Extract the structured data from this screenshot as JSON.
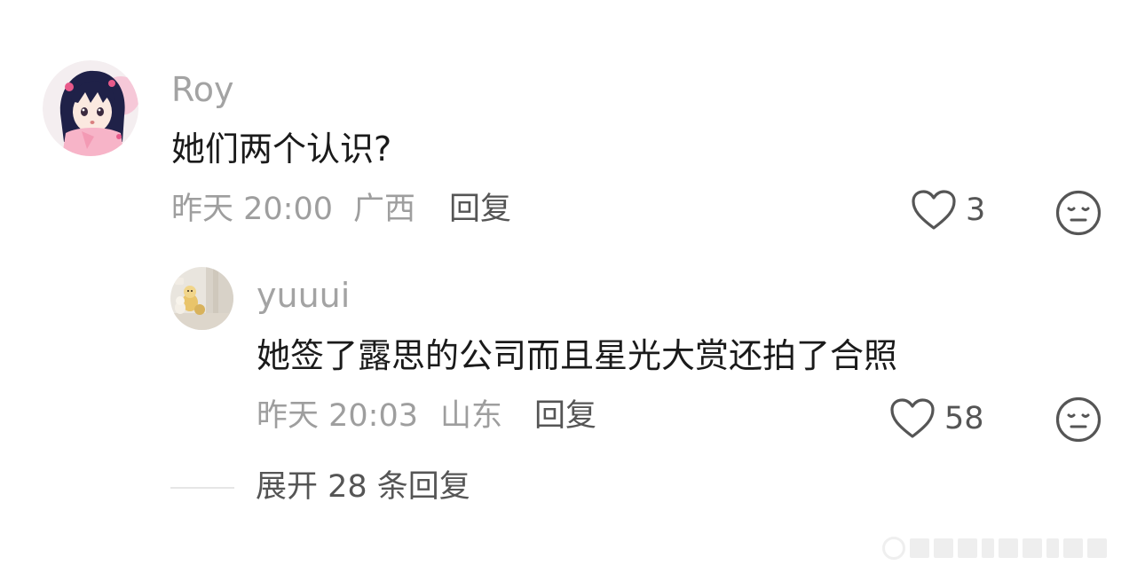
{
  "comment": {
    "username": "Roy",
    "text": "她们两个认识?",
    "time": "昨天 20:00",
    "location": "广西",
    "reply_label": "回复",
    "like_count": "3",
    "avatar_icon": "anime-girl-avatar"
  },
  "reply": {
    "username": "yuuui",
    "text": "她签了露思的公司而且星光大赏还拍了合照",
    "time": "昨天 20:03",
    "location": "山东",
    "reply_label": "回复",
    "like_count": "58",
    "avatar_icon": "plush-toy-photo-avatar"
  },
  "expand": {
    "label": "展开 28 条回复"
  },
  "icons": {
    "like": "heart-outline-icon",
    "emoji": "neutral-face-icon"
  },
  "colors": {
    "username": "#a3a3a3",
    "text": "#1a1a1a",
    "meta": "#9e9e9e",
    "action": "#555555"
  }
}
